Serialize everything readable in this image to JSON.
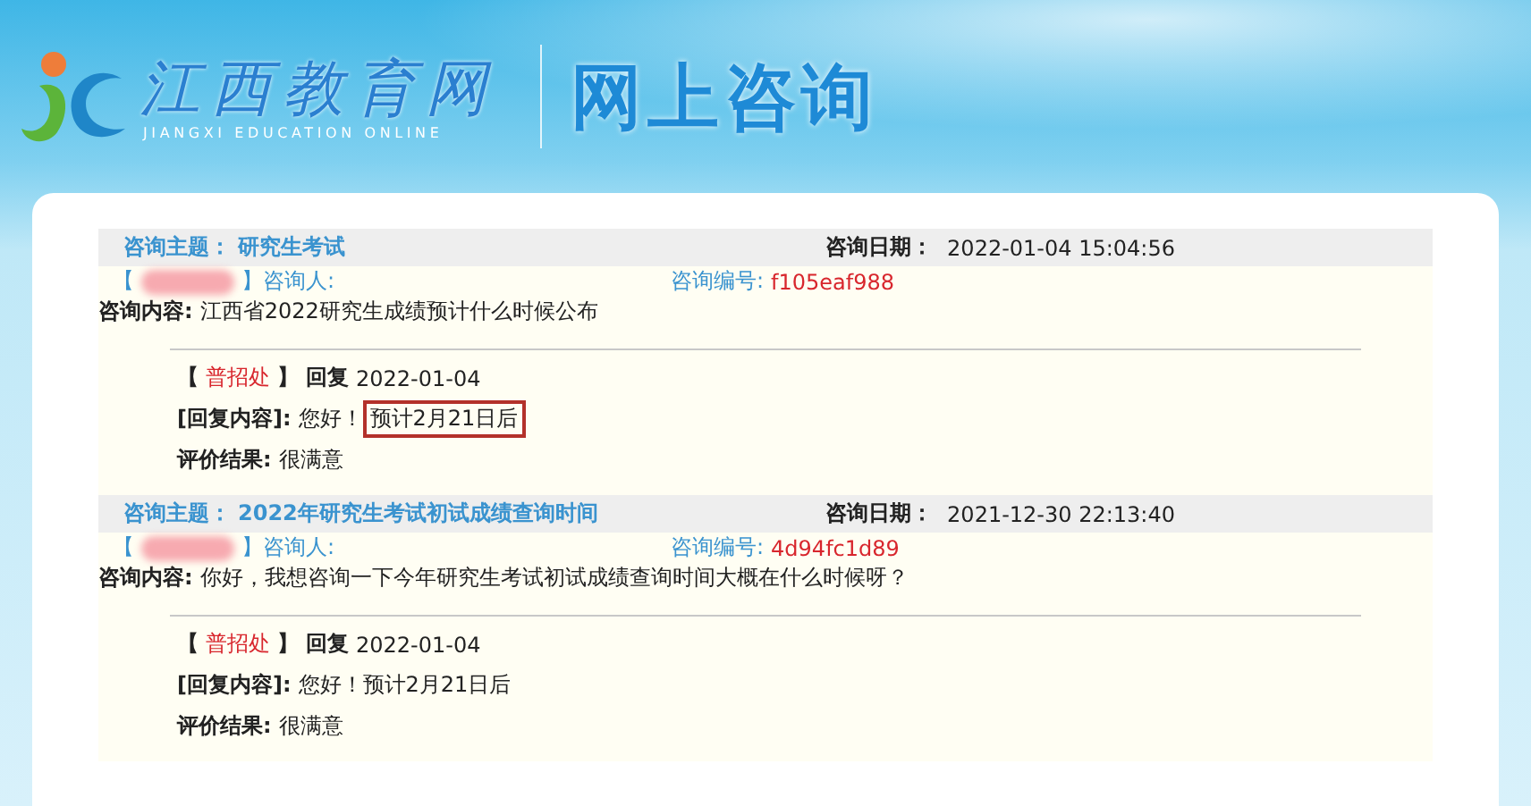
{
  "header": {
    "site_name": "江西教育网",
    "site_subtitle": "JIANGXI EDUCATION ONLINE",
    "section_title": "网上咨询"
  },
  "consultations": [
    {
      "topic_label": "咨询主题：",
      "topic": "研究生考试",
      "date_label": "咨询日期：",
      "date": "2022-01-04 15:04:56",
      "asker_open": "【",
      "asker_close": "】咨询人:",
      "asker_redacted": true,
      "number_label": "咨询编号:",
      "number": "f105eaf988",
      "content_label": "咨询内容:",
      "content": "江西省2022研究生成绩预计什么时候公布",
      "reply": {
        "open": "【",
        "replier": "普招处",
        "close": "】",
        "reply_label": "回复",
        "reply_date": "2022-01-04",
        "content_label": "[回复内容]:",
        "greeting": "您好！",
        "answer": "预计2月21日后",
        "highlighted": true,
        "rating_label": "评价结果:",
        "rating": "很满意"
      }
    },
    {
      "topic_label": "咨询主题：",
      "topic": "2022年研究生考试初试成绩查询时间",
      "date_label": "咨询日期：",
      "date": "2021-12-30 22:13:40",
      "asker_open": "【",
      "asker_close": "】咨询人:",
      "asker_redacted": true,
      "number_label": "咨询编号:",
      "number": "4d94fc1d89",
      "content_label": "咨询内容:",
      "content": "你好，我想咨询一下今年研究生考试初试成绩查询时间大概在什么时候呀？",
      "reply": {
        "open": "【",
        "replier": "普招处",
        "close": "】",
        "reply_label": "回复",
        "reply_date": "2022-01-04",
        "content_label": "[回复内容]:",
        "greeting": "您好！",
        "answer": "预计2月21日后",
        "highlighted": false,
        "rating_label": "评价结果:",
        "rating": "很满意"
      }
    }
  ]
}
